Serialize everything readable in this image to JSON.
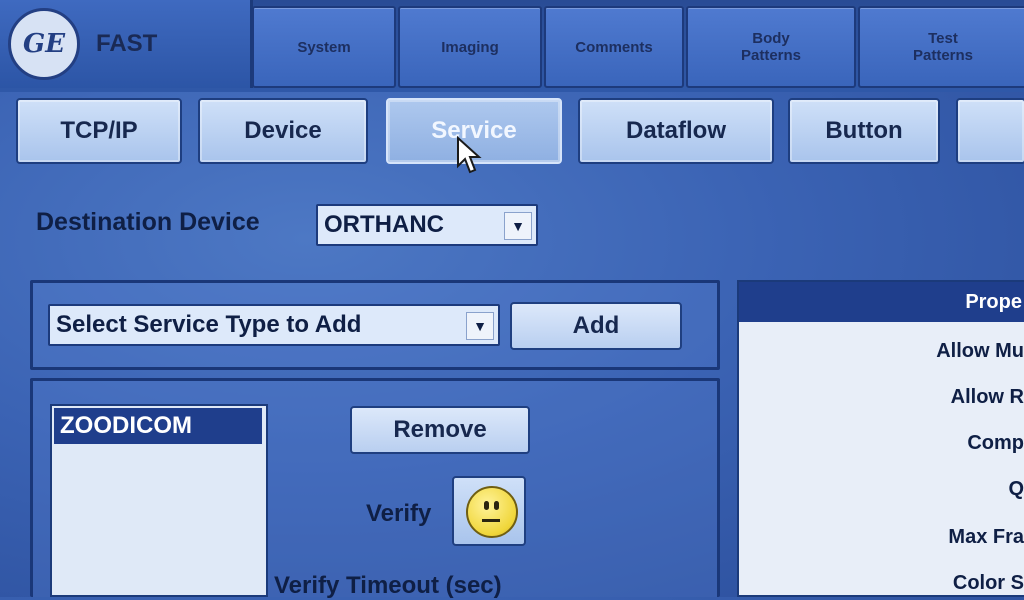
{
  "app": {
    "logo_text": "GE",
    "title": "FAST"
  },
  "top_tabs": [
    {
      "label": "System"
    },
    {
      "label": "Imaging"
    },
    {
      "label": "Comments"
    },
    {
      "label": "Body\nPatterns"
    },
    {
      "label": "Test\nPatterns"
    }
  ],
  "sub_tabs": [
    {
      "label": "TCP/IP"
    },
    {
      "label": "Device"
    },
    {
      "label": "Service",
      "active": true
    },
    {
      "label": "Dataflow"
    },
    {
      "label": "Button"
    },
    {
      "label": ""
    }
  ],
  "destination": {
    "label": "Destination Device",
    "value": "ORTHANC"
  },
  "service_type": {
    "value": "Select Service Type to Add",
    "add_label": "Add"
  },
  "services": {
    "items": [
      "ZOODICOM"
    ],
    "remove_label": "Remove",
    "verify_label": "Verify",
    "verify_timeout_label": "Verify Timeout (sec)"
  },
  "properties": {
    "header": "Prope",
    "rows": [
      "Allow Mu",
      "Allow R",
      "Comp",
      "Q",
      "Max Fra",
      "Color S"
    ]
  },
  "colors": {
    "background": "#3b63b4",
    "accent": "#1f3e8c",
    "smiley": "#f0d63a"
  }
}
